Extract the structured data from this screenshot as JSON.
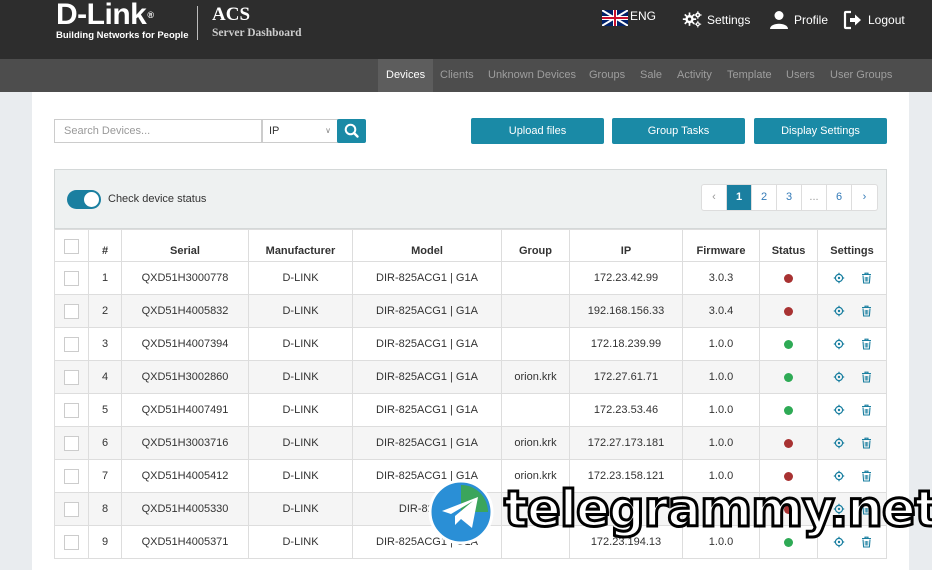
{
  "brand": {
    "logo_text": "D-Link",
    "logo_reg": "®",
    "tagline": "Building Networks for People",
    "app_title": "ACS",
    "app_subtitle": "Server Dashboard"
  },
  "top_menu": {
    "language": "ENG",
    "settings": "Settings",
    "profile": "Profile",
    "logout": "Logout"
  },
  "nav": [
    "Devices",
    "Clients",
    "Unknown Devices",
    "Groups",
    "Sale",
    "Activity",
    "Template",
    "Users",
    "User Groups"
  ],
  "search": {
    "placeholder": "Search Devices...",
    "field_select": "IP"
  },
  "actions": {
    "upload": "Upload files",
    "group_tasks": "Group Tasks",
    "display_settings": "Display Settings"
  },
  "status_toggle": {
    "label": "Check device status",
    "on": true
  },
  "pagination": {
    "prev": "‹",
    "pages": [
      "1",
      "2",
      "3",
      "...",
      "6"
    ],
    "current": "1",
    "next": "›"
  },
  "table": {
    "columns": [
      "#",
      "Serial",
      "Manufacturer",
      "Model",
      "Group",
      "IP",
      "Firmware",
      "Status",
      "Settings"
    ],
    "rows": [
      {
        "n": "1",
        "serial": "QXD51H3000778",
        "manufacturer": "D-LINK",
        "model": "DIR-825ACG1 | G1A",
        "group": "",
        "ip": "172.23.42.99",
        "firmware": "3.0.3",
        "status": "offline"
      },
      {
        "n": "2",
        "serial": "QXD51H4005832",
        "manufacturer": "D-LINK",
        "model": "DIR-825ACG1 | G1A",
        "group": "",
        "ip": "192.168.156.33",
        "firmware": "3.0.4",
        "status": "offline"
      },
      {
        "n": "3",
        "serial": "QXD51H4007394",
        "manufacturer": "D-LINK",
        "model": "DIR-825ACG1 | G1A",
        "group": "",
        "ip": "172.18.239.99",
        "firmware": "1.0.0",
        "status": "online"
      },
      {
        "n": "4",
        "serial": "QXD51H3002860",
        "manufacturer": "D-LINK",
        "model": "DIR-825ACG1 | G1A",
        "group": "orion.krk",
        "ip": "172.27.61.71",
        "firmware": "1.0.0",
        "status": "online"
      },
      {
        "n": "5",
        "serial": "QXD51H4007491",
        "manufacturer": "D-LINK",
        "model": "DIR-825ACG1 | G1A",
        "group": "",
        "ip": "172.23.53.46",
        "firmware": "1.0.0",
        "status": "online"
      },
      {
        "n": "6",
        "serial": "QXD51H3003716",
        "manufacturer": "D-LINK",
        "model": "DIR-825ACG1 | G1A",
        "group": "orion.krk",
        "ip": "172.27.173.181",
        "firmware": "1.0.0",
        "status": "offline"
      },
      {
        "n": "7",
        "serial": "QXD51H4005412",
        "manufacturer": "D-LINK",
        "model": "DIR-825ACG1 | G1A",
        "group": "orion.krk",
        "ip": "172.23.158.121",
        "firmware": "1.0.0",
        "status": "offline"
      },
      {
        "n": "8",
        "serial": "QXD51H4005330",
        "manufacturer": "D-LINK",
        "model": "DIR-825AC",
        "group": "",
        "ip": "",
        "firmware": "",
        "status": "offline"
      },
      {
        "n": "9",
        "serial": "QXD51H4005371",
        "manufacturer": "D-LINK",
        "model": "DIR-825ACG1 | G1A",
        "group": "",
        "ip": "172.23.194.13",
        "firmware": "1.0.0",
        "status": "online"
      }
    ]
  },
  "colors": {
    "accent": "#1a8aa6",
    "status_offline": "#a83232",
    "status_online": "#2eaa55"
  },
  "watermark": {
    "text": "telegrammy.net"
  }
}
